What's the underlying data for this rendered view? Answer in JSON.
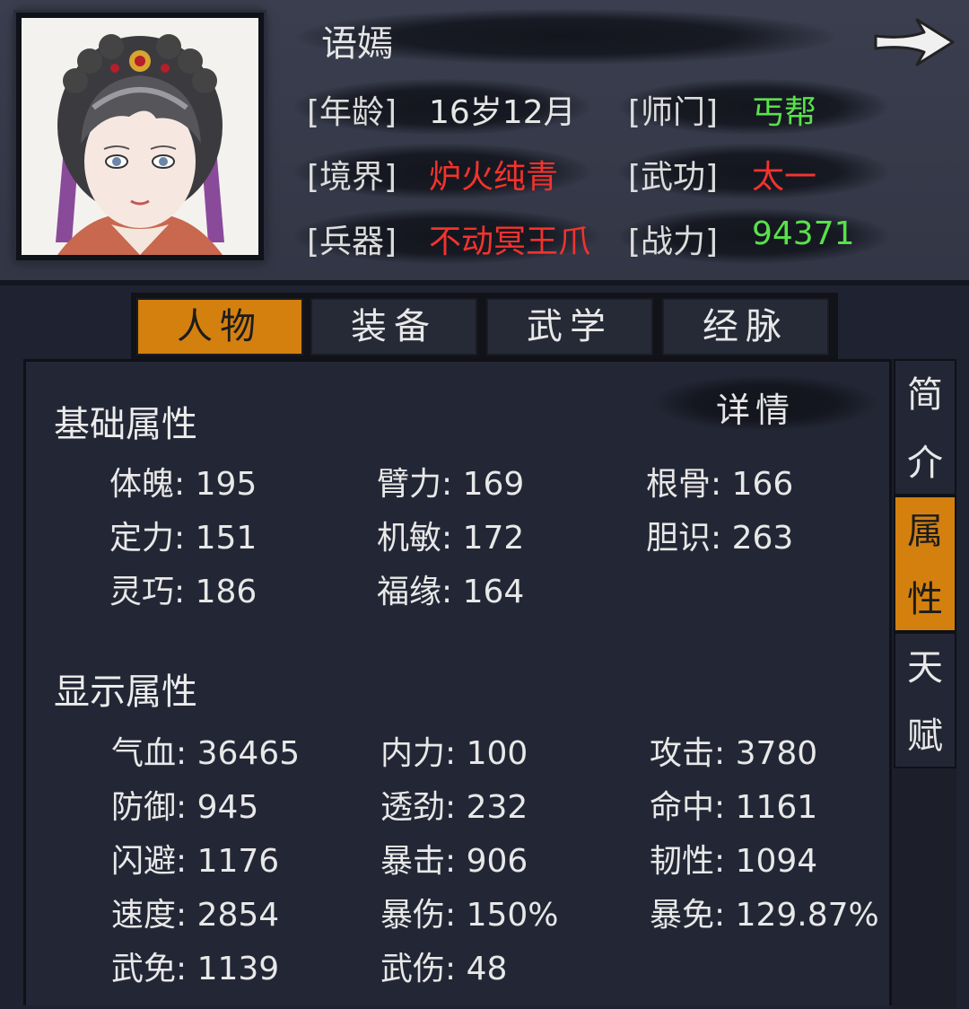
{
  "character": {
    "name": "语嫣",
    "info": [
      {
        "label": "[年龄]",
        "value": "16岁12月"
      },
      {
        "label": "[师门]",
        "value": "丐帮"
      },
      {
        "label": "[境界]",
        "value": "炉火纯青"
      },
      {
        "label": "[武功]",
        "value": "太一"
      },
      {
        "label": "[兵器]",
        "value": "不动冥王爪"
      },
      {
        "label": "[战力]",
        "value": "94371"
      }
    ]
  },
  "tabs": [
    "人物",
    "装备",
    "武学",
    "经脉"
  ],
  "active_tab": "人物",
  "side_tabs": [
    {
      "chars": [
        "简",
        "介"
      ]
    },
    {
      "chars": [
        "属",
        "性"
      ]
    },
    {
      "chars": [
        "天",
        "赋"
      ]
    }
  ],
  "active_side_tab": "属性",
  "details_label": "详情",
  "base_attrs": {
    "title": "基础属性",
    "items": [
      "体魄: 195",
      "臂力: 169",
      "根骨: 166",
      "定力: 151",
      "机敏: 172",
      "胆识: 263",
      "灵巧: 186",
      "福缘: 164"
    ]
  },
  "display_attrs": {
    "title": "显示属性",
    "items": [
      "气血: 36465",
      "内力: 100",
      "攻击: 3780",
      "防御: 945",
      "透劲: 232",
      "命中: 1161",
      "闪避: 1176",
      "暴击: 906",
      "韧性: 1094",
      "速度: 2854",
      "暴伤: 150%",
      "暴免: 129.87%",
      "武免: 1139",
      "武伤: 48"
    ]
  },
  "colors": {
    "accent": "#d3800f",
    "green": "#58e24a",
    "red": "#f2332d"
  }
}
